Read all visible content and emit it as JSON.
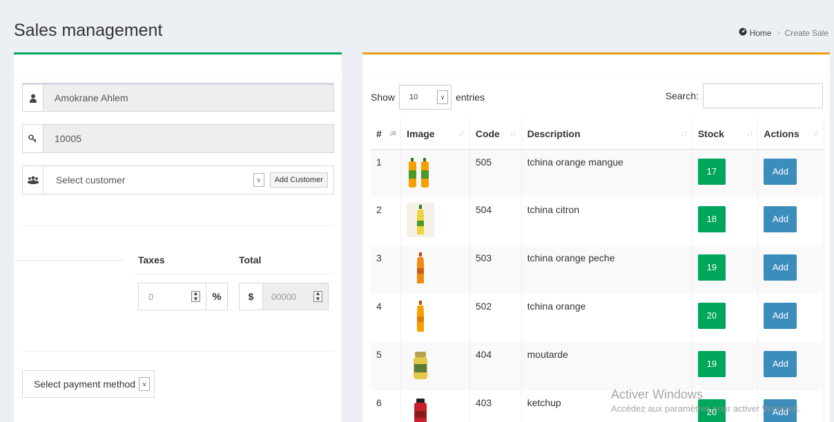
{
  "header": {
    "title": "Sales management",
    "breadcrumb": {
      "home": "Home",
      "separator": ">",
      "current": "Create Sale"
    }
  },
  "left": {
    "seller": "Amokrane Ahlem",
    "code": "10005",
    "customer_select": "Select customer",
    "add_customer": "Add Customer",
    "taxes_label": "Taxes",
    "taxes_value": "0",
    "percent_symbol": "%",
    "total_label": "Total",
    "currency_symbol": "$",
    "total_value": "00000",
    "payment_select": "Select payment method"
  },
  "right": {
    "show_label": "Show",
    "entries_value": "10",
    "entries_label": "entries",
    "search_label": "Search:",
    "columns": [
      "#",
      "Image",
      "Code",
      "Description",
      "Stock",
      "Actions"
    ],
    "add_label": "Add",
    "rows": [
      {
        "num": "1",
        "code": "505",
        "description": "tchina orange mangue",
        "stock": "17",
        "image": "two-orange-bottles"
      },
      {
        "num": "2",
        "code": "504",
        "description": "tchina citron",
        "stock": "18",
        "image": "yellow-bottle"
      },
      {
        "num": "3",
        "code": "503",
        "description": "tchina orange peche",
        "stock": "19",
        "image": "orange-bottle"
      },
      {
        "num": "4",
        "code": "502",
        "description": "tchina orange",
        "stock": "20",
        "image": "orange-bottle"
      },
      {
        "num": "5",
        "code": "404",
        "description": "moutarde",
        "stock": "19",
        "image": "mustard-jar"
      },
      {
        "num": "6",
        "code": "403",
        "description": "ketchup",
        "stock": "20",
        "image": "ketchup-bottle"
      }
    ]
  },
  "watermark": {
    "line1": "Activer Windows",
    "line2": "Accédez aux paramètres pour activer Windows."
  },
  "colors": {
    "green": "#00a65a",
    "orange": "#f39c12",
    "blue": "#3c8dbc"
  }
}
